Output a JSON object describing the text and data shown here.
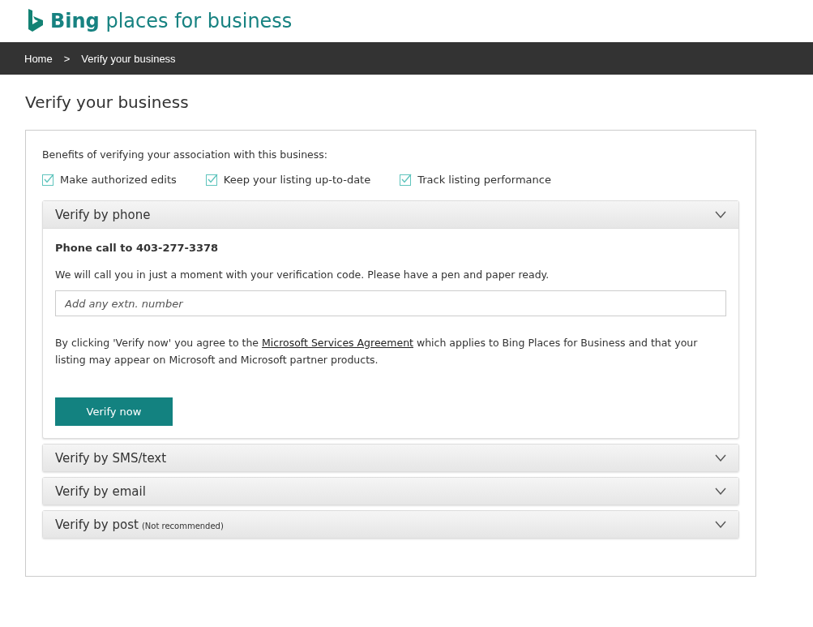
{
  "logo": {
    "text": "**Bing** places for business"
  },
  "breadcrumb": [
    {
      "label": "Home"
    },
    {
      "label": "Verify your business"
    }
  ],
  "breadcrumb_separator": ">",
  "page_title": "Verify your business",
  "benefits": {
    "heading": "Benefits of verifying your association with this business:",
    "items": [
      {
        "label": "Make authorized edits",
        "checked": true
      },
      {
        "label": "Keep your listing up-to-date",
        "checked": true
      },
      {
        "label": "Track listing performance",
        "checked": true
      }
    ]
  },
  "sections": [
    {
      "title": "Verify by phone",
      "body": {
        "phone_line": "Phone call to 403-277-3378",
        "info": "We will call you in just a moment with your verification code. Please have a pen and paper ready.",
        "extension_field": {
          "placeholder": "Add any extn. number"
        },
        "agreement_before": "By clicking 'Verify now' you agree to the ",
        "agreement_link": "Microsoft Services Agreement",
        "agreement_after": " which applies to Bing Places for Business and that your listing may appear on Microsoft and Microsoft partner products.",
        "button": "Verify now"
      }
    },
    {
      "title": "Verify by SMS/text"
    },
    {
      "title": "Verify by email"
    },
    {
      "title": "Verify by post",
      "note": "(Not recommended)"
    }
  ]
}
